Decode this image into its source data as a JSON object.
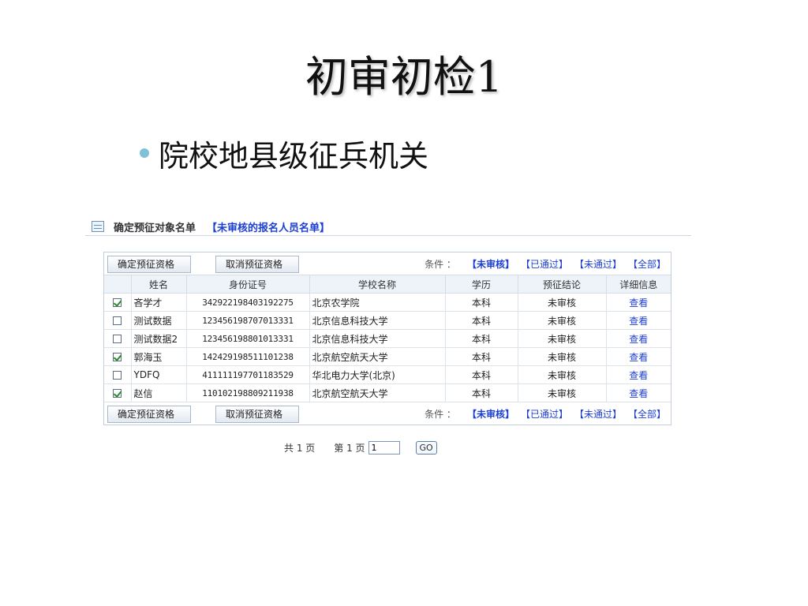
{
  "slide": {
    "title": "初审初检1",
    "bullet": "院校地县级征兵机关"
  },
  "panel": {
    "title": "确定预征对象名单",
    "subtitle": "【未审核的报名人员名单】"
  },
  "toolbar": {
    "confirm_label": "确定预征资格",
    "cancel_label": "取消预征资格",
    "filter_label": "条件 ：",
    "filters": [
      "【未审核】",
      "【已通过】",
      "【未通过】",
      "【全部】"
    ],
    "active_filter": "【未审核】"
  },
  "table": {
    "headers": [
      "",
      "姓名",
      "身份证号",
      "学校名称",
      "学历",
      "预征结论",
      "详细信息"
    ],
    "rows": [
      {
        "checked": true,
        "name": "吝学才",
        "id": "342922198403192275",
        "school": "北京农学院",
        "edu": "本科",
        "status": "未审核",
        "action": "查看"
      },
      {
        "checked": false,
        "name": "测试数据",
        "id": "123456198707013331",
        "school": "北京信息科技大学",
        "edu": "本科",
        "status": "未审核",
        "action": "查看"
      },
      {
        "checked": false,
        "name": "测试数据2",
        "id": "123456198801013331",
        "school": "北京信息科技大学",
        "edu": "本科",
        "status": "未审核",
        "action": "查看"
      },
      {
        "checked": true,
        "name": "郭海玉",
        "id": "142429198511101238",
        "school": "北京航空航天大学",
        "edu": "本科",
        "status": "未审核",
        "action": "查看"
      },
      {
        "checked": false,
        "name": "YDFQ",
        "id": "411111197701183529",
        "school": "华北电力大学(北京)",
        "edu": "本科",
        "status": "未审核",
        "action": "查看"
      },
      {
        "checked": true,
        "name": "赵信",
        "id": "110102198809211938",
        "school": "北京航空航天大学",
        "edu": "本科",
        "status": "未审核",
        "action": "查看"
      }
    ]
  },
  "pager": {
    "total": "共 1 页",
    "current": "第 1 页",
    "input_value": "1",
    "go_label": "GO"
  },
  "colors": {
    "link": "#1c3fd1",
    "bullet": "#7fc2d6",
    "header_bg": "#eef3f9"
  }
}
